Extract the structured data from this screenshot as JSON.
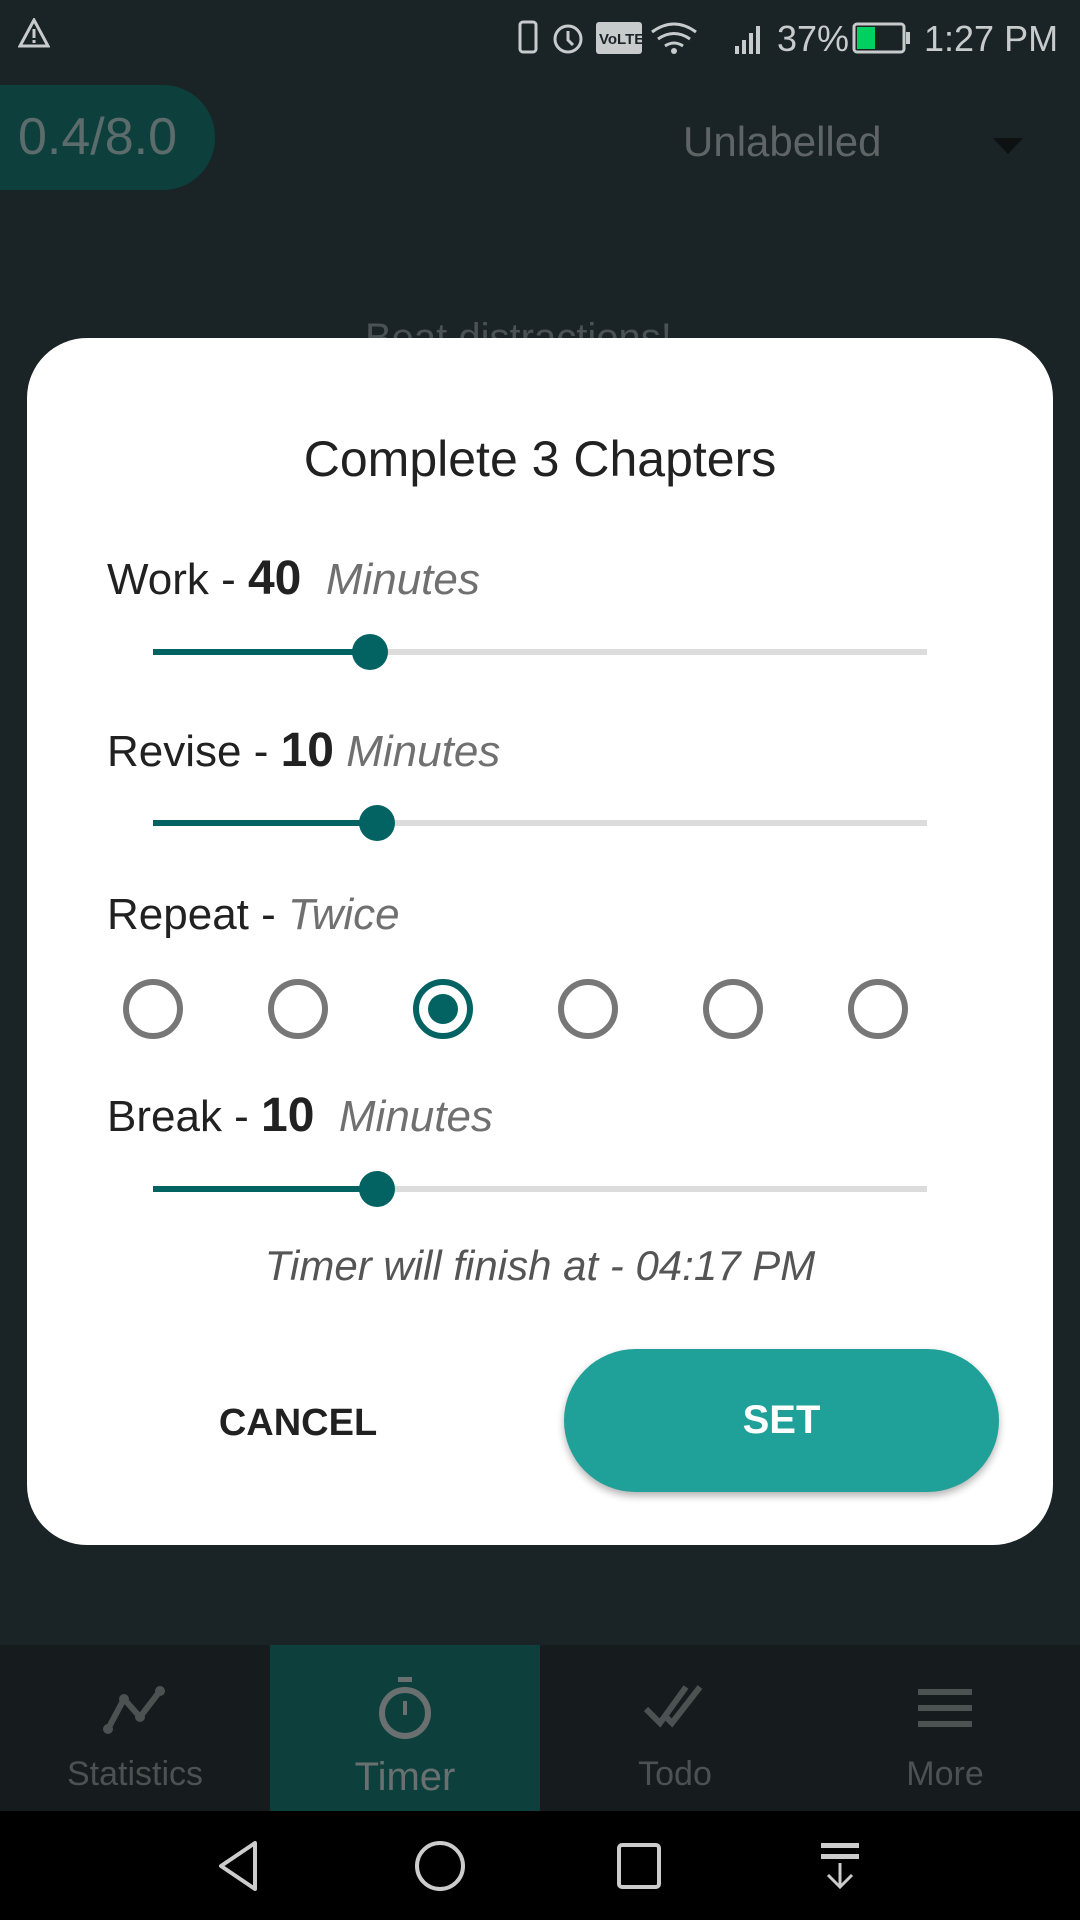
{
  "status_bar": {
    "battery": "37%",
    "time": "1:27 PM",
    "icons": [
      "warning-icon",
      "vibrate-icon",
      "alarm-icon",
      "volte-icon",
      "wifi-icon",
      "signal-icon",
      "battery-charging-icon"
    ]
  },
  "header": {
    "progress": "0.4/8.0",
    "label_select": "Unlabelled"
  },
  "background_text": "Beat distractions!",
  "dialog": {
    "title": "Complete 3 Chapters",
    "work": {
      "label": "Work - ",
      "value": "40",
      "unit": "Minutes",
      "slider_fraction": 0.28
    },
    "revise": {
      "label": "Revise - ",
      "value": "10",
      "unit": "Minutes",
      "slider_fraction": 0.29
    },
    "repeat": {
      "label": "Repeat - ",
      "value": "Twice",
      "options_count": 6,
      "selected_index": 2
    },
    "break": {
      "label": "Break - ",
      "value": "10",
      "unit": "Minutes",
      "slider_fraction": 0.29
    },
    "finish_text": "Timer will finish at - 04:17 PM",
    "cancel_label": "CANCEL",
    "set_label": "SET"
  },
  "bottom_nav": [
    {
      "label": "Statistics",
      "icon": "chart-line-icon"
    },
    {
      "label": "Timer",
      "icon": "stopwatch-icon",
      "active": true
    },
    {
      "label": "Todo",
      "icon": "double-check-icon"
    },
    {
      "label": "More",
      "icon": "menu-icon"
    }
  ],
  "colors": {
    "accent": "#036262",
    "button": "#1fa098",
    "background": "#1a2326"
  }
}
